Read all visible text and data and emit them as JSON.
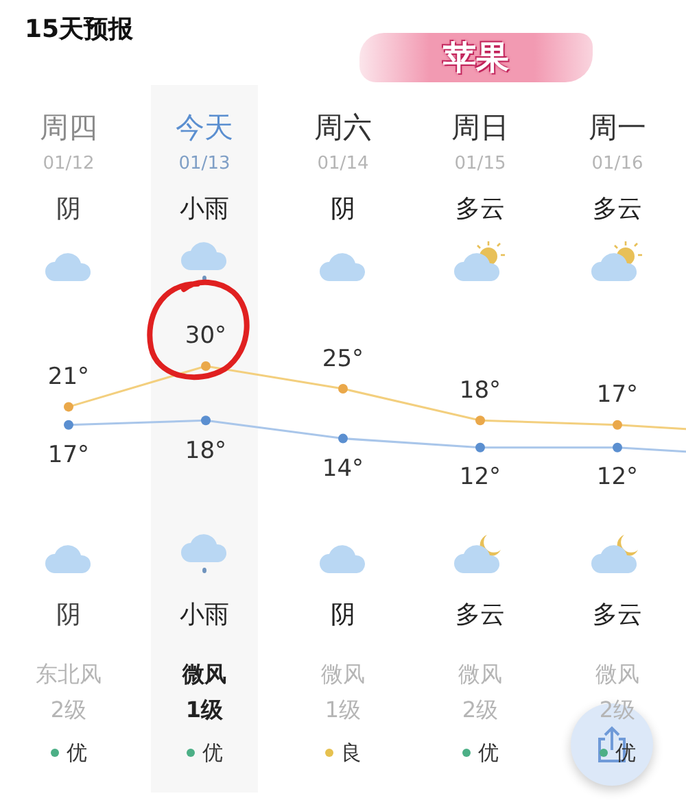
{
  "header": {
    "title": "15天预报"
  },
  "annotation": {
    "text": "苹果"
  },
  "days": [
    {
      "weekday": "周四",
      "date": "01/12",
      "day_weather": "阴",
      "day_icon": {
        "kind": "cloudy"
      },
      "high": "21°",
      "low": "17°",
      "night_icon": {
        "kind": "cloudy"
      },
      "night_weather": "阴",
      "wind_direction": "东北风",
      "wind_level": "2级",
      "aqi": {
        "label": "优",
        "color": "#4caf86"
      },
      "selected": false,
      "past": true
    },
    {
      "weekday": "今天",
      "date": "01/13",
      "day_weather": "小雨",
      "day_icon": {
        "kind": "rain"
      },
      "high": "30°",
      "low": "18°",
      "night_icon": {
        "kind": "rain"
      },
      "night_weather": "小雨",
      "wind_direction": "微风",
      "wind_level": "1级",
      "aqi": {
        "label": "优",
        "color": "#4caf86"
      },
      "selected": true,
      "past": false
    },
    {
      "weekday": "周六",
      "date": "01/14",
      "day_weather": "阴",
      "day_icon": {
        "kind": "cloudy"
      },
      "high": "25°",
      "low": "14°",
      "night_icon": {
        "kind": "cloudy"
      },
      "night_weather": "阴",
      "wind_direction": "微风",
      "wind_level": "1级",
      "aqi": {
        "label": "良",
        "color": "#e6c14f"
      },
      "selected": false,
      "past": false
    },
    {
      "weekday": "周日",
      "date": "01/15",
      "day_weather": "多云",
      "day_icon": {
        "kind": "partly_cloudy"
      },
      "high": "18°",
      "low": "12°",
      "night_icon": {
        "kind": "partly_cloudy_night"
      },
      "night_weather": "多云",
      "wind_direction": "微风",
      "wind_level": "2级",
      "aqi": {
        "label": "优",
        "color": "#4caf86"
      },
      "selected": false,
      "past": false
    },
    {
      "weekday": "周一",
      "date": "01/16",
      "day_weather": "多云",
      "day_icon": {
        "kind": "partly_cloudy"
      },
      "high": "17°",
      "low": "12°",
      "night_icon": {
        "kind": "partly_cloudy_night"
      },
      "night_weather": "多云",
      "wind_direction": "微风",
      "wind_level": "2级",
      "aqi": {
        "label": "优",
        "color": "#4caf86"
      },
      "selected": false,
      "past": false
    }
  ]
}
